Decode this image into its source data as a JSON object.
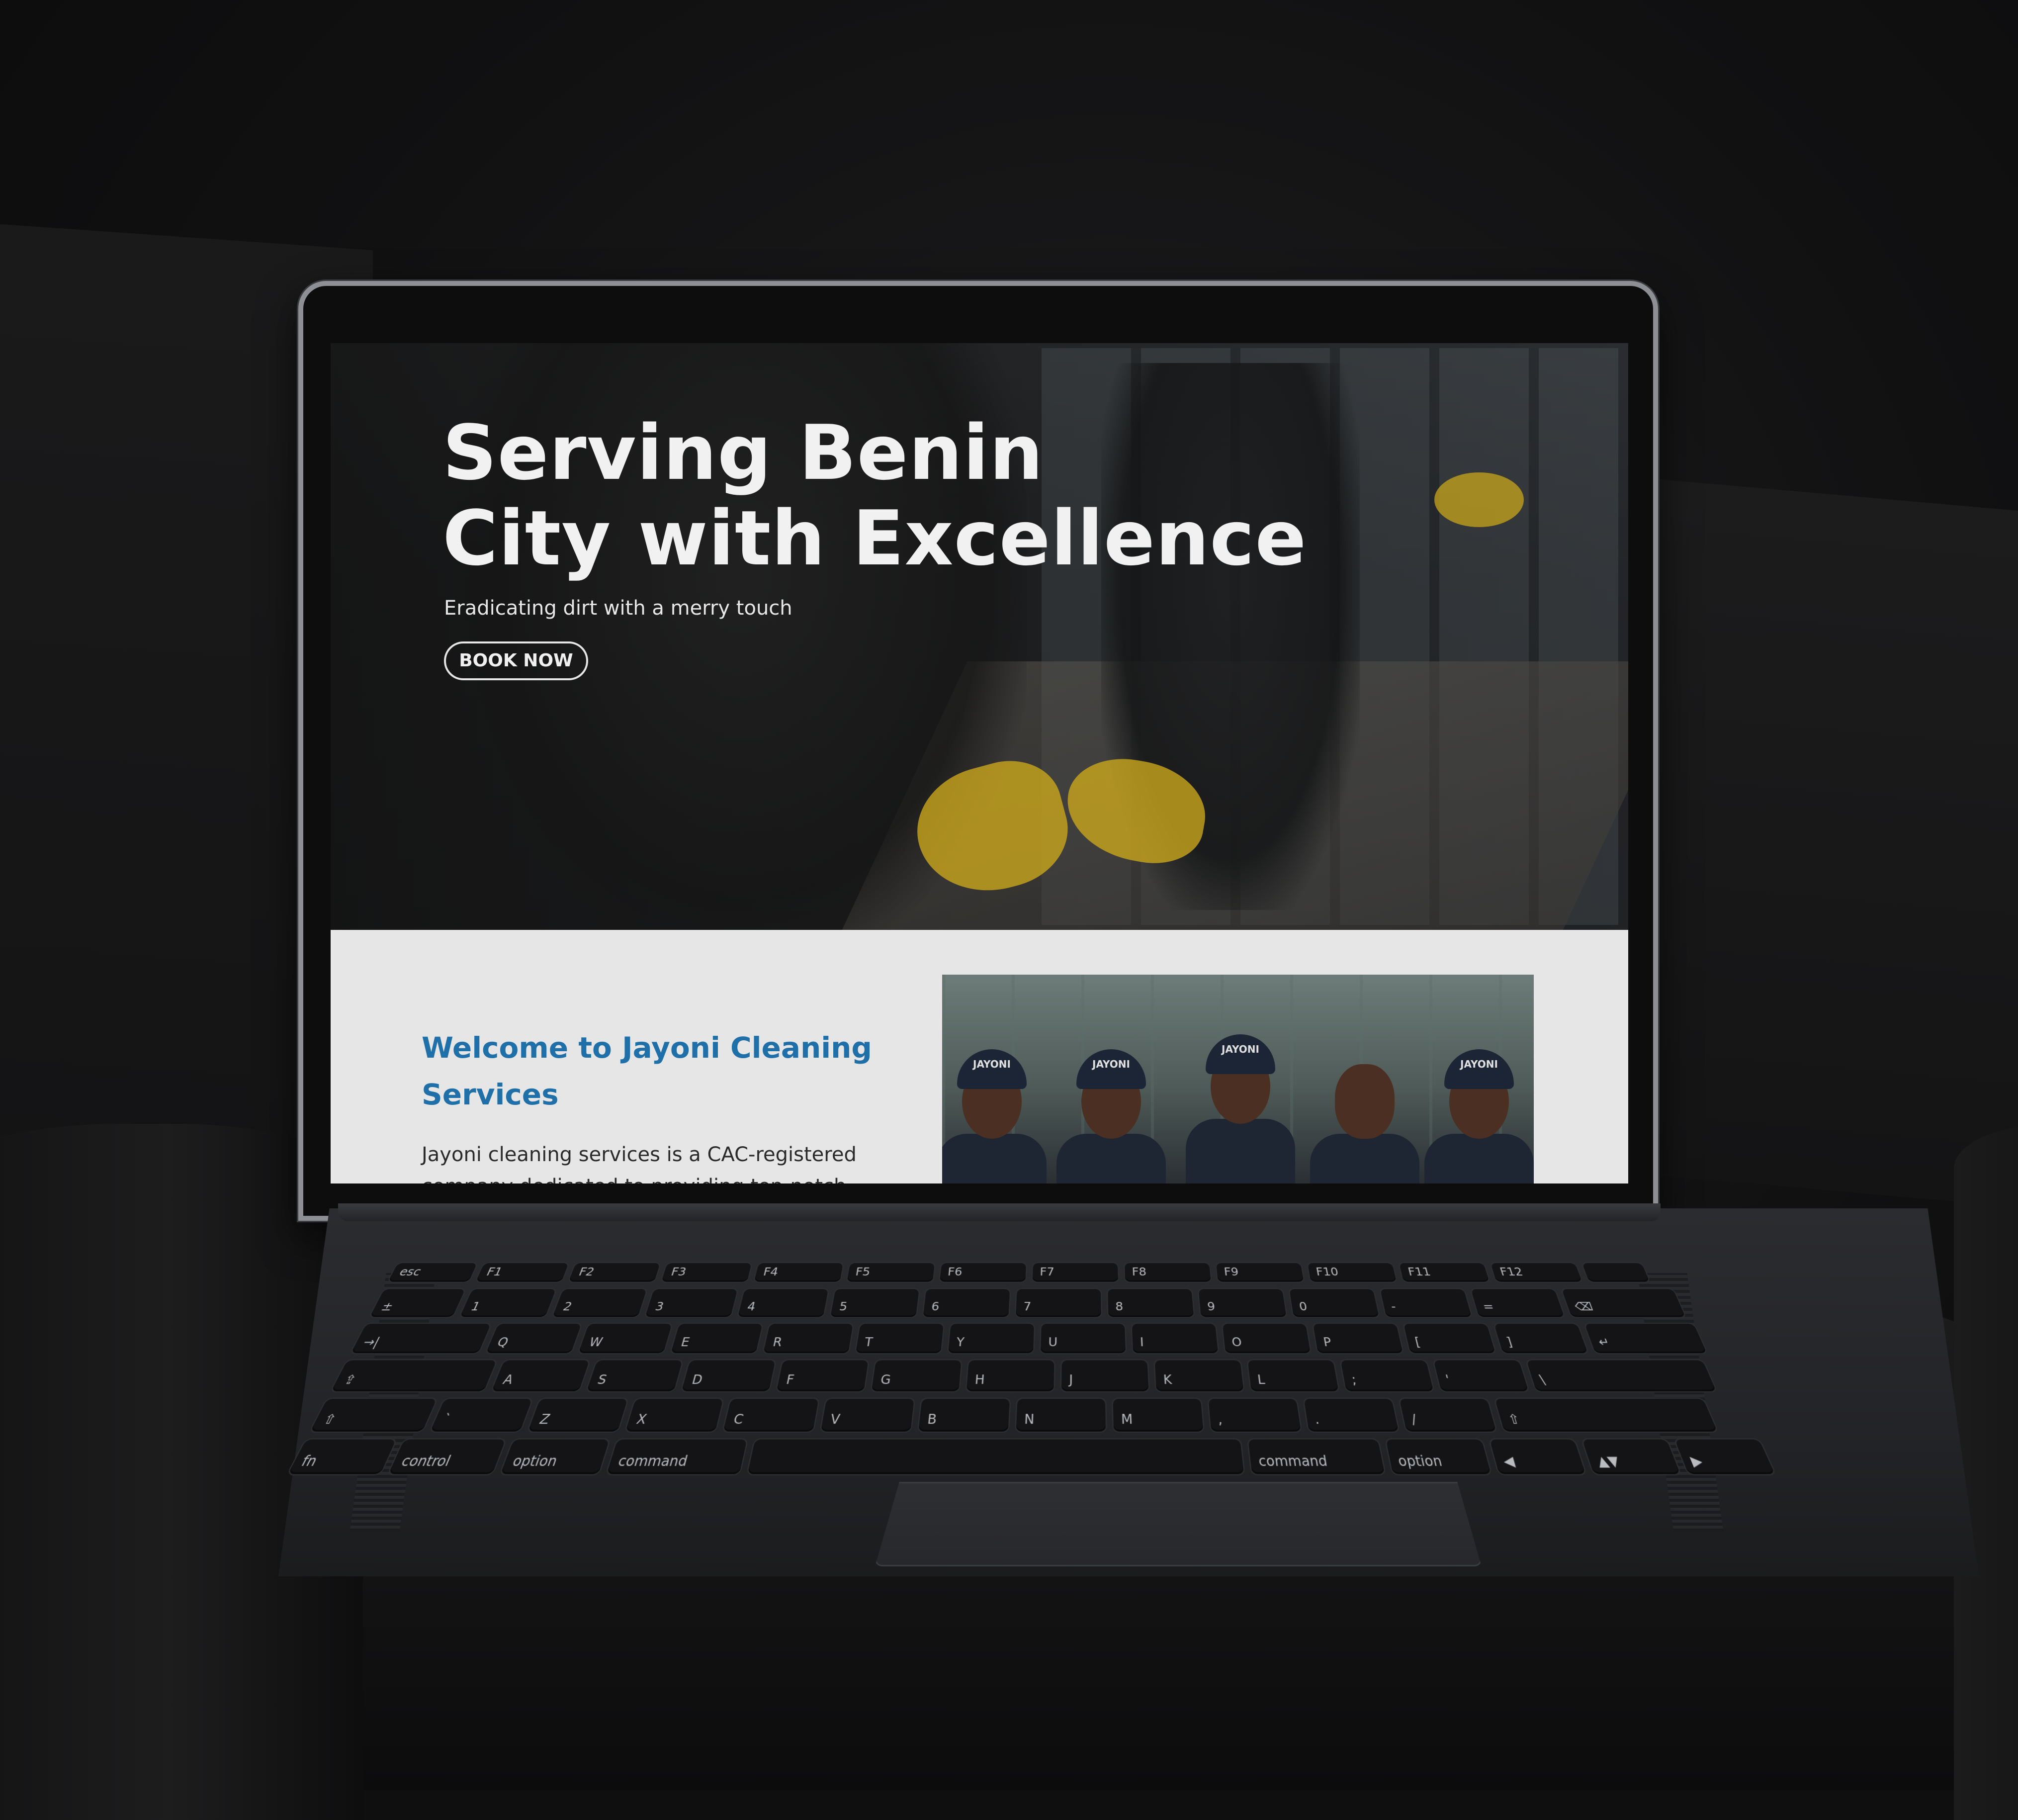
{
  "hero": {
    "title_line1": "Serving Benin",
    "title_line2": "City with Excellence",
    "subtitle": "Eradicating dirt with a merry touch",
    "cta_label": "BOOK NOW"
  },
  "welcome": {
    "title": "Welcome to Jayoni Cleaning Services",
    "body": "Jayoni cleaning services is a CAC-registered company dedicated to providing top-notch",
    "photo_caps": [
      "JAYONI",
      "JAYONI",
      "JAYONI",
      "JAYONI"
    ]
  },
  "keyboard": {
    "rows": [
      [
        "esc",
        "F1",
        "F2",
        "F3",
        "F4",
        "F5",
        "F6",
        "F7",
        "F8",
        "F9",
        "F10",
        "F11",
        "F12",
        ""
      ],
      [
        "±",
        "1",
        "2",
        "3",
        "4",
        "5",
        "6",
        "7",
        "8",
        "9",
        "0",
        "-",
        "=",
        "⌫"
      ],
      [
        "→|",
        "Q",
        "W",
        "E",
        "R",
        "T",
        "Y",
        "U",
        "I",
        "O",
        "P",
        "[",
        "]",
        "↵"
      ],
      [
        "⇪",
        "A",
        "S",
        "D",
        "F",
        "G",
        "H",
        "J",
        "K",
        "L",
        ";",
        "'",
        "\\"
      ],
      [
        "⇧",
        "`",
        "Z",
        "X",
        "C",
        "V",
        "B",
        "N",
        "M",
        ",",
        ".",
        "/",
        "⇧"
      ],
      [
        "fn",
        "control",
        "option",
        "command",
        "",
        "command",
        "option",
        "◀",
        "▲▼",
        "▶"
      ]
    ]
  }
}
